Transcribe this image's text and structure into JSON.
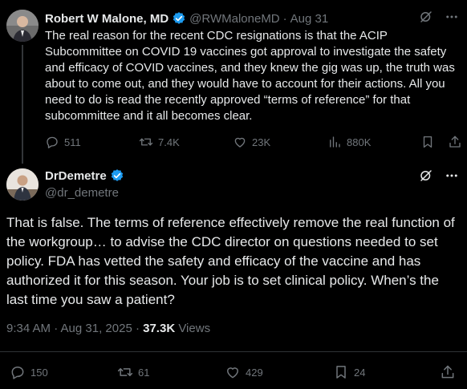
{
  "parent_tweet": {
    "author_name": "Robert W Malone, MD",
    "handle": "@RWMaloneMD",
    "separator": "·",
    "time": "Aug 31",
    "text": "The real reason for the recent CDC resignations is that the ACIP Subcommittee on COVID 19 vaccines got approval to investigate the safety and efficacy of COVID vaccines, and they knew the gig was up, the truth was about to come out, and they would have to account for their actions. All you need to do is read the recently approved “terms of reference” for that subcommittee and it all becomes clear.",
    "replies": "511",
    "reposts": "7.4K",
    "likes": "23K",
    "views": "880K"
  },
  "reply_tweet": {
    "author_name": "DrDemetre",
    "handle": "@dr_demetre",
    "text": "That is false. The terms of reference effectively remove the real function of the workgroup… to advise the CDC director on questions needed to set policy.  FDA has vetted the safety and efficacy of the vaccine and has authorized it for this season. Your job is to set clinical policy.  When’s the last time you saw a patient?",
    "timestamp": "9:34 AM · Aug 31, 2025 · ",
    "views_count": "37.3K",
    "views_label": " Views",
    "replies": "150",
    "reposts": "61",
    "likes": "429",
    "bookmarks": "24"
  },
  "colors": {
    "background": "#000000",
    "text": "#e7e9ea",
    "muted": "#71767b",
    "verified": "#1d9bf0"
  }
}
